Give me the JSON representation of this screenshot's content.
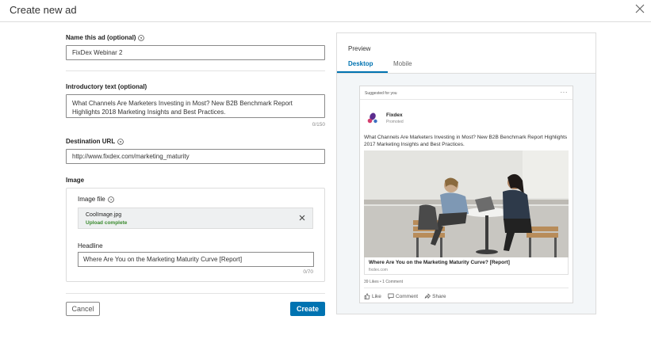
{
  "window": {
    "title": "Create new ad"
  },
  "form": {
    "name_label": "Name this ad (optional)",
    "name_value": "FixDex Webinar 2",
    "intro_label": "Introductory text (optional)",
    "intro_value": "What Channels Are Marketers Investing in Most? New B2B Benchmark Report Highlights 2018 Marketing Insights and Best Practices.",
    "intro_counter": "0/150",
    "url_label": "Destination URL",
    "url_value": "http://www.fixdex.com/marketing_maturity",
    "image_section_label": "Image",
    "image_file_label": "Image file",
    "image_file_name": "CoolImage.jpg",
    "image_upload_status": "Upload complete",
    "headline_label": "Headline",
    "headline_value": "Where Are You on the Marketing Maturity Curve [Report]",
    "headline_counter": "0/70",
    "cancel_label": "Cancel",
    "create_label": "Create"
  },
  "preview": {
    "title": "Preview",
    "tabs": [
      {
        "label": "Desktop",
        "active": true
      },
      {
        "label": "Mobile",
        "active": false
      }
    ],
    "card": {
      "suggested": "Suggested for you",
      "more": "···",
      "company": "Fixdex",
      "promoted": "Promoted",
      "intro": "What Channels Are Marketers Investing in Most? New B2B Benchmark Report Highlights 2017 Marketing Insights and Best Practices.",
      "link_headline": "Where Are You on the Marketing Maturity Curve? [Report]",
      "link_domain": "fixdex.com",
      "stats": "39 Likes • 1 Comment",
      "actions": {
        "like": "Like",
        "comment": "Comment",
        "share": "Share"
      }
    }
  },
  "colors": {
    "accent": "#0073b1",
    "success": "#3a8a2e",
    "preview_bg": "#f3f6f8"
  },
  "icons": {
    "close": "close-icon",
    "help": "help-circle-icon",
    "remove_file": "remove-icon",
    "like": "thumbs-up-icon",
    "comment": "comment-icon",
    "share": "share-icon"
  }
}
